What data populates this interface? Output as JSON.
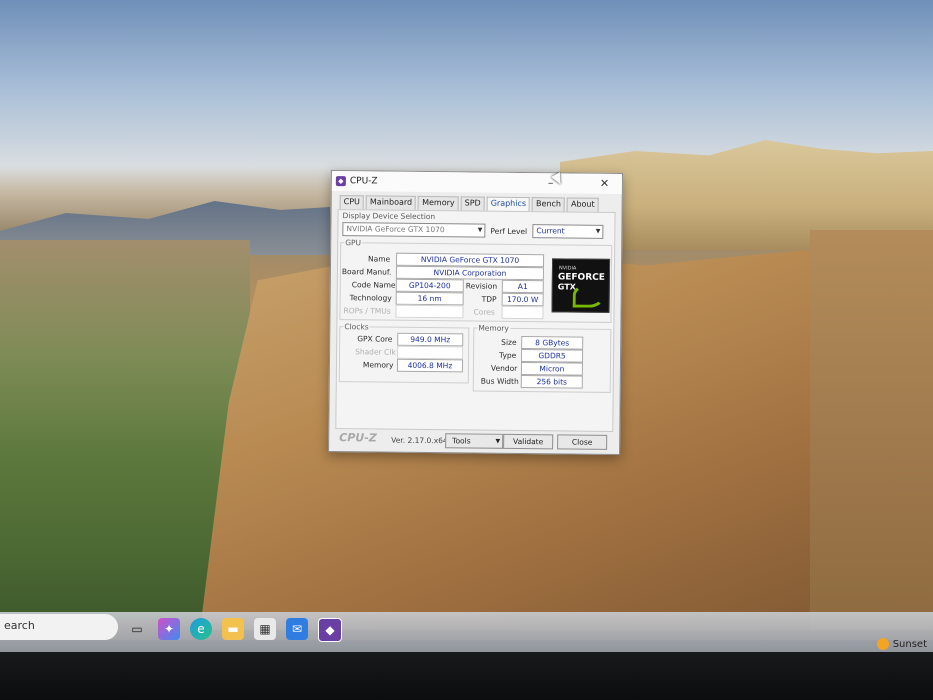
{
  "window": {
    "title": "CPU-Z",
    "minimize": "–",
    "close": "✕"
  },
  "tabs": [
    "CPU",
    "Mainboard",
    "Memory",
    "SPD",
    "Graphics",
    "Bench",
    "About"
  ],
  "active_tab": "Graphics",
  "display_device": {
    "section_label": "Display Device Selection",
    "selected": "NVIDIA GeForce GTX 1070",
    "perf_label": "Perf Level",
    "perf_value": "Current"
  },
  "gpu": {
    "section_label": "GPU",
    "name_label": "Name",
    "name": "NVIDIA GeForce GTX 1070",
    "board_label": "Board Manuf.",
    "board": "NVIDIA Corporation",
    "code_label": "Code Name",
    "code": "GP104-200",
    "revision_label": "Revision",
    "revision": "A1",
    "tech_label": "Technology",
    "tech": "16 nm",
    "tdp_label": "TDP",
    "tdp": "170.0 W",
    "rops_label": "ROPs / TMUs",
    "cores_label": "Cores"
  },
  "logo": {
    "line1": "NVIDIA",
    "line2": "GEFORCE",
    "line3": "GTX"
  },
  "clocks": {
    "section_label": "Clocks",
    "core_label": "GPX Core",
    "core": "949.0 MHz",
    "shader_label": "Shader Clk",
    "memory_label": "Memory",
    "memory": "4006.8 MHz"
  },
  "memory": {
    "section_label": "Memory",
    "size_label": "Size",
    "size": "8 GBytes",
    "type_label": "Type",
    "type": "GDDR5",
    "vendor_label": "Vendor",
    "vendor": "Micron",
    "bus_label": "Bus Width",
    "bus": "256 bits"
  },
  "footer": {
    "brand": "CPU-Z",
    "version": "Ver. 2.17.0.x64",
    "tools": "Tools",
    "validate": "Validate",
    "close": "Close"
  },
  "taskbar": {
    "search_text": "earch",
    "weather": "Sunset"
  }
}
